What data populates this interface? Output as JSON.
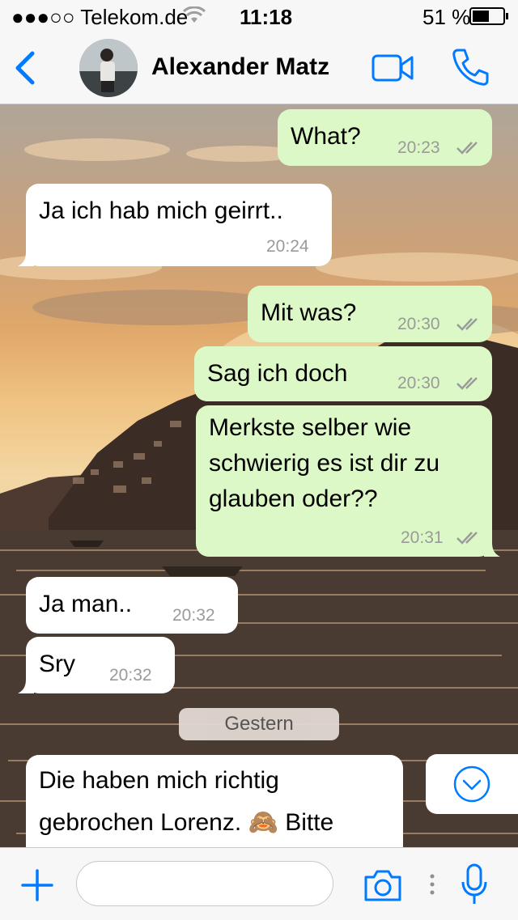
{
  "status_bar": {
    "carrier": "●●●○○ Telekom.de",
    "time": "11:18",
    "battery": "51 %"
  },
  "header": {
    "contact_name": "Alexander Matz"
  },
  "messages": [
    {
      "direction": "outgoing",
      "text": "What?",
      "time": "20:23",
      "status": "read"
    },
    {
      "direction": "incoming",
      "text": "Ja ich hab mich geirrt..",
      "time": "20:24"
    },
    {
      "direction": "outgoing",
      "text": "Mit was?",
      "time": "20:30",
      "status": "read"
    },
    {
      "direction": "outgoing",
      "text": "Sag ich doch",
      "time": "20:30",
      "status": "read"
    },
    {
      "direction": "outgoing",
      "lines": [
        "Merkste selber wie",
        "schwierig es ist dir zu",
        "glauben oder??"
      ],
      "time": "20:31",
      "status": "read"
    },
    {
      "direction": "incoming",
      "text": "Ja man..",
      "time": "20:32"
    },
    {
      "direction": "incoming",
      "text": "Sry",
      "time": "20:32"
    },
    {
      "direction": "incoming",
      "lines": [
        "Die haben mich richtig",
        "gebrochen Lorenz. 🙈  Bitte"
      ]
    }
  ],
  "date_separator": "Gestern",
  "colors": {
    "accent": "#007aff",
    "outgoing_bubble": "#dcf8c6",
    "incoming_bubble": "#ffffff",
    "bar_background": "#f7f7f7"
  },
  "icons": [
    "wifi-icon",
    "battery-icon",
    "back-chevron-icon",
    "video-call-icon",
    "phone-call-icon",
    "read-ticks-icon",
    "scroll-down-icon",
    "plus-icon",
    "camera-icon",
    "more-dots-icon",
    "microphone-icon"
  ],
  "composer": {
    "value": "",
    "placeholder": ""
  }
}
